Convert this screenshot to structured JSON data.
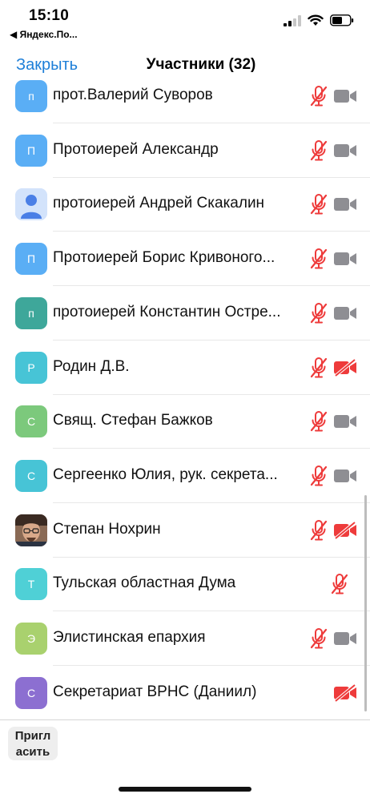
{
  "status_bar": {
    "time": "15:10",
    "back_app": "◀ Яндекс.По...",
    "icons": [
      "signal-icon",
      "wifi-icon",
      "battery-icon"
    ]
  },
  "nav": {
    "close_label": "Закрыть",
    "title": "Участники (32)"
  },
  "colors": {
    "accent": "#1e7fd8",
    "muted_red": "#ee3b3b",
    "camera_gray": "#8e8e93"
  },
  "participants": [
    {
      "initial": "п",
      "name": "прот.Валерий Суворов",
      "avatar_color": "#5aaef5",
      "mic": "muted",
      "camera": "on"
    },
    {
      "initial": "П",
      "name": "Протоиерей Александр",
      "avatar_color": "#5aaef5",
      "mic": "muted",
      "camera": "on"
    },
    {
      "initial": "",
      "name": "протоиерей Андрей Скакалин",
      "avatar_color": "#d3e3fb",
      "avatar_icon": "person-icon",
      "mic": "muted",
      "camera": "on"
    },
    {
      "initial": "П",
      "name": "Протоиерей Борис Кривоного...",
      "avatar_color": "#5aaef5",
      "mic": "muted",
      "camera": "on"
    },
    {
      "initial": "п",
      "name": "протоиерей Константин Остре...",
      "avatar_color": "#3ea79a",
      "mic": "muted",
      "camera": "on"
    },
    {
      "initial": "Р",
      "name": "Родин Д.В.",
      "avatar_color": "#47c4d6",
      "mic": "muted",
      "camera": "off"
    },
    {
      "initial": "С",
      "name": "Свящ. Стефан Бажков",
      "avatar_color": "#7cc97c",
      "mic": "muted",
      "camera": "on"
    },
    {
      "initial": "С",
      "name": "Сергеенко Юлия, рук. секрета...",
      "avatar_color": "#47c4d6",
      "mic": "muted",
      "camera": "on"
    },
    {
      "initial": "",
      "name": "Степан Нохрин",
      "avatar_color": "#6b4a3a",
      "avatar_icon": "photo-avatar",
      "mic": "muted",
      "camera": "off"
    },
    {
      "initial": "Т",
      "name": "Тульская областная Дума",
      "avatar_color": "#4fd0d6",
      "mic": "muted",
      "camera": "none"
    },
    {
      "initial": "Э",
      "name": "Элистинская епархия",
      "avatar_color": "#a9d16e",
      "mic": "muted",
      "camera": "on"
    },
    {
      "initial": "С",
      "name": "Секретариат ВРНС (Даниил)",
      "avatar_color": "#8c6fd1",
      "mic": "none",
      "camera": "off"
    }
  ],
  "bottom": {
    "invite_label_line1": "Пригл",
    "invite_label_line2": "асить"
  }
}
